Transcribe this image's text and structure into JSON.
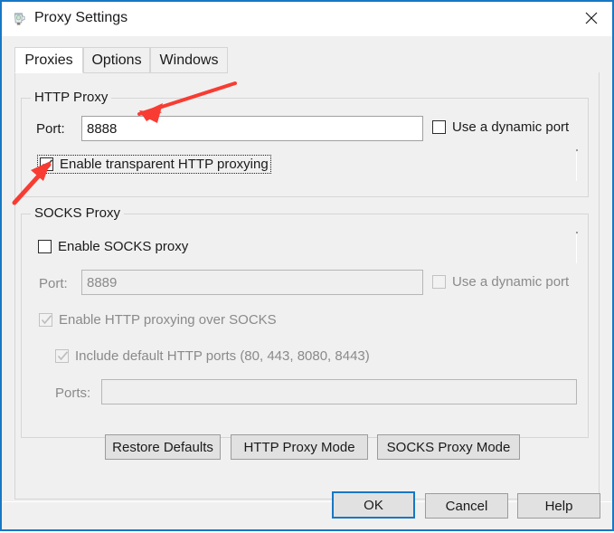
{
  "window": {
    "title": "Proxy Settings",
    "icon": "charles-proxy-icon",
    "close_label": "✕",
    "border_color": "#1777c4"
  },
  "tabs": [
    {
      "label": "Proxies",
      "selected": true
    },
    {
      "label": "Options",
      "selected": false
    },
    {
      "label": "Windows",
      "selected": false
    }
  ],
  "http_proxy": {
    "group_title": "HTTP Proxy",
    "port_label": "Port:",
    "port_value": "8888",
    "port_placeholder": "",
    "dynamic_port_label": "Use a dynamic port",
    "dynamic_port_checked": false,
    "transparent_label": "Enable transparent HTTP proxying",
    "transparent_checked": true,
    "transparent_focused": true
  },
  "socks_proxy": {
    "group_title": "SOCKS Proxy",
    "enable_label": "Enable SOCKS proxy",
    "enable_checked": false,
    "port_label": "Port:",
    "port_value": "8889",
    "dynamic_port_label": "Use a dynamic port",
    "dynamic_port_checked": false,
    "http_over_socks_label": "Enable HTTP proxying over SOCKS",
    "http_over_socks_checked": true,
    "include_default_ports_label": "Include default HTTP ports (80, 443, 8080, 8443)",
    "include_default_ports_checked": true,
    "ports_label": "Ports:",
    "ports_value": ""
  },
  "mode_buttons": [
    {
      "label": "Restore Defaults"
    },
    {
      "label": "HTTP Proxy Mode"
    },
    {
      "label": "SOCKS Proxy Mode"
    }
  ],
  "dialog_buttons": [
    {
      "label": "OK",
      "default": true
    },
    {
      "label": "Cancel",
      "default": false
    },
    {
      "label": "Help",
      "default": false
    }
  ],
  "annotations": {
    "color": "#f83c33",
    "arrow_1_name": "arrow-pointing-to-port-field",
    "arrow_2_name": "arrow-pointing-to-transparent-checkbox"
  }
}
